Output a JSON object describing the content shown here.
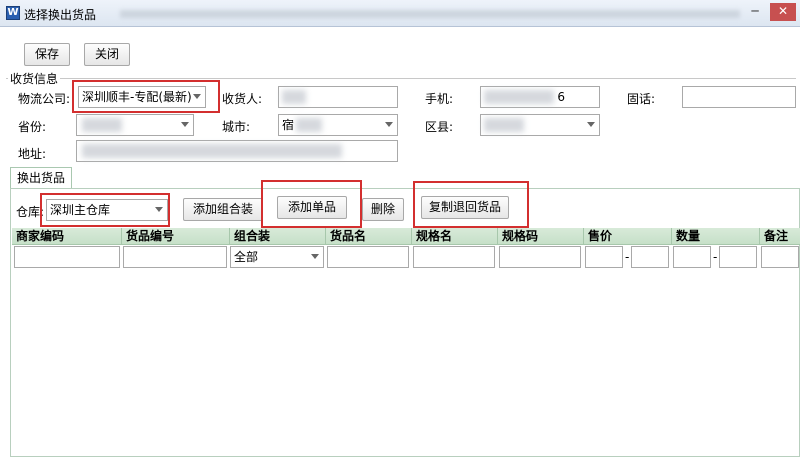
{
  "window": {
    "title": "选择换出货品",
    "minimize": "─",
    "close": "✕",
    "app_icon": "app-icon"
  },
  "toolbar": {
    "save_label": "保存",
    "close_label": "关闭"
  },
  "receiving": {
    "legend": "收货信息",
    "logistics_label": "物流公司:",
    "logistics_value": "深圳顺丰-专配(最新)",
    "receiver_label": "收货人:",
    "mobile_label": "手机:",
    "mobile_value_partial": "6",
    "phone_label": "固话:",
    "province_label": "省份:",
    "city_label": "城市:",
    "city_value_partial": "宿",
    "district_label": "区县:",
    "address_label": "地址:"
  },
  "tab": {
    "label": "换出货品"
  },
  "actions": {
    "warehouse_label": "仓库:",
    "warehouse_value": "深圳主仓库",
    "add_combo_label": "添加组合装",
    "add_single_label": "添加单品",
    "delete_label": "删除",
    "copy_return_label": "复制退回货品"
  },
  "grid": {
    "columns": [
      "商家编码",
      "货品编号",
      "组合装",
      "货品名",
      "规格名",
      "规格码",
      "售价",
      "数量",
      "备注"
    ],
    "combo_filter_value": "全部",
    "range_separator": "-"
  },
  "colors": {
    "highlight": "#d32f2f",
    "grid_header": "#c6e0c8"
  }
}
